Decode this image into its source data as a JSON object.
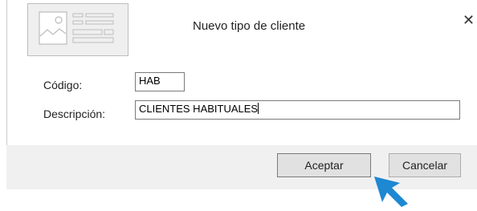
{
  "dialog": {
    "title": "Nuevo tipo de cliente",
    "close_glyph": "✕"
  },
  "form": {
    "code_label": "Código:",
    "code_value": "HAB",
    "description_label": "Descripción:",
    "description_value": "CLIENTES HABITUALES"
  },
  "buttons": {
    "accept": "Aceptar",
    "cancel": "Cancelar"
  },
  "icons": {
    "header_image": "image-placeholder-icon",
    "pointer": "arrow-pointer-icon"
  },
  "colors": {
    "pointer": "#1e88d2"
  }
}
